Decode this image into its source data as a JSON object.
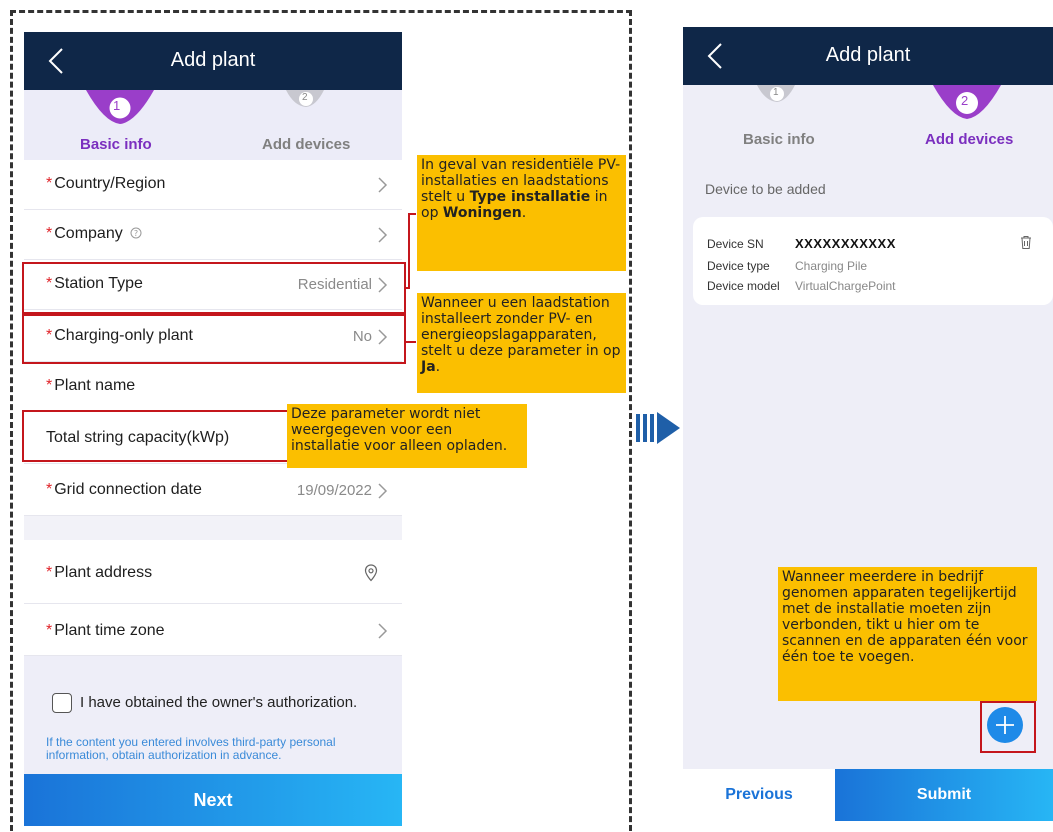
{
  "left": {
    "title": "Add plant",
    "steps": [
      {
        "number": "1",
        "label": "Basic info"
      },
      {
        "number": "2",
        "label": "Add devices"
      }
    ],
    "fields": {
      "country": {
        "label": "Country/Region"
      },
      "company": {
        "label": "Company"
      },
      "station_type": {
        "label": "Station Type",
        "value": "Residential"
      },
      "charging_only": {
        "label": "Charging-only plant",
        "value": "No"
      },
      "plant_name": {
        "label": "Plant name"
      },
      "total_string": {
        "label": "Total string capacity(kWp)"
      },
      "grid_date": {
        "label": "Grid connection date",
        "value": "19/09/2022"
      },
      "plant_address": {
        "label": "Plant address"
      },
      "time_zone": {
        "label": "Plant time zone"
      }
    },
    "required_mark": "*",
    "authorization": {
      "checkbox_label": "I have obtained the owner's authorization.",
      "notice": "If the content you entered involves third-party personal information, obtain authorization in advance."
    },
    "next_label": "Next"
  },
  "callouts": {
    "station_type": {
      "part1": "In geval van residentiële PV-installaties en laadstations stelt u ",
      "bold1": "Type installatie",
      "part2": " in op ",
      "bold2": "Woningen",
      "part3": "."
    },
    "charging_only": {
      "part1": "Wanneer u een laadstation installeert zonder PV- en energieopslagapparaten, stelt u deze parameter in op ",
      "bold1": "Ja",
      "part2": "."
    },
    "total_string": "Deze parameter wordt niet weergegeven voor een installatie voor alleen opladen.",
    "add_device": "Wanneer meerdere in bedrijf genomen apparaten tegelijkertijd met de installatie moeten zijn verbonden, tikt u hier om te scannen en de apparaten één voor één toe te voegen."
  },
  "right": {
    "title": "Add plant",
    "steps": [
      {
        "number": "1",
        "label": "Basic info"
      },
      {
        "number": "2",
        "label": "Add devices"
      }
    ],
    "section_label": "Device to be added",
    "device": {
      "sn_label": "Device SN",
      "sn_value": "XXXXXXXXXXX",
      "type_label": "Device type",
      "type_value": "Charging Pile",
      "model_label": "Device model",
      "model_value": "VirtualChargePoint"
    },
    "previous_label": "Previous",
    "submit_label": "Submit"
  },
  "colors": {
    "appbar": "#0f2748",
    "active_step": "#7b2fbf",
    "required": "#e0242a",
    "highlight_box": "#c4161c",
    "callout": "#fbbf00",
    "button_start": "#1a73d8",
    "button_end": "#27b6f5"
  },
  "icons": [
    "back-icon",
    "chevron-right-icon",
    "help-icon",
    "location-pin-icon",
    "trash-icon",
    "plus-icon",
    "next-arrow-icon"
  ]
}
